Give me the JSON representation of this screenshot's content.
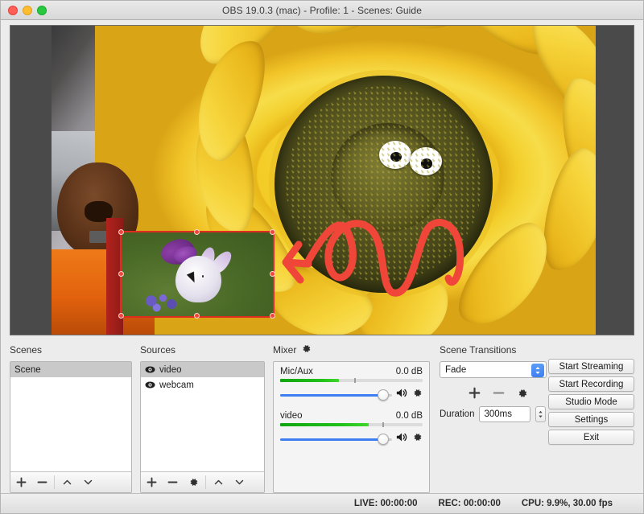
{
  "window": {
    "title": "OBS 19.0.3 (mac) - Profile: 1 - Scenes: Guide"
  },
  "scenes": {
    "title": "Scenes",
    "items": [
      {
        "label": "Scene",
        "selected": true
      }
    ],
    "toolbar": {
      "add": "+",
      "remove": "−",
      "move_up": "⌃",
      "move_down": "⌄"
    }
  },
  "sources": {
    "title": "Sources",
    "items": [
      {
        "label": "video",
        "visible": true,
        "selected": true
      },
      {
        "label": "webcam",
        "visible": true,
        "selected": false
      }
    ],
    "toolbar": {
      "add": "+",
      "remove": "−",
      "properties": "gear-icon",
      "move_up": "⌃",
      "move_down": "⌄"
    }
  },
  "mixer": {
    "title": "Mixer",
    "settings_icon": "gear-icon",
    "channels": [
      {
        "name": "Mic/Aux",
        "level": "0.0 dB",
        "meter_pct": 41,
        "volume_pct": 92
      },
      {
        "name": "video",
        "level": "0.0 dB",
        "meter_pct": 62,
        "volume_pct": 92
      }
    ]
  },
  "transitions": {
    "title": "Scene Transitions",
    "selected": "Fade",
    "options": [
      "Fade"
    ],
    "add": "+",
    "remove": "−",
    "properties": "gear-icon",
    "duration_label": "Duration",
    "duration_value": "300ms"
  },
  "controls": {
    "buttons": [
      "Start Streaming",
      "Start Recording",
      "Studio Mode",
      "Settings",
      "Exit"
    ]
  },
  "status": {
    "live": "LIVE: 00:00:00",
    "rec": "REC: 00:00:00",
    "cpu": "CPU: 9.9%, 30.00 fps"
  },
  "preview": {
    "selection_color": "#e02b1f",
    "annotation_color": "#f0463a",
    "backdrop_color": "#4a4a4a"
  },
  "colors": {
    "accent_blue": "#3d7ff2",
    "meter_green": "#21c21a",
    "close": "#ff5f57",
    "minimize": "#febc2e",
    "zoom": "#28c840"
  }
}
